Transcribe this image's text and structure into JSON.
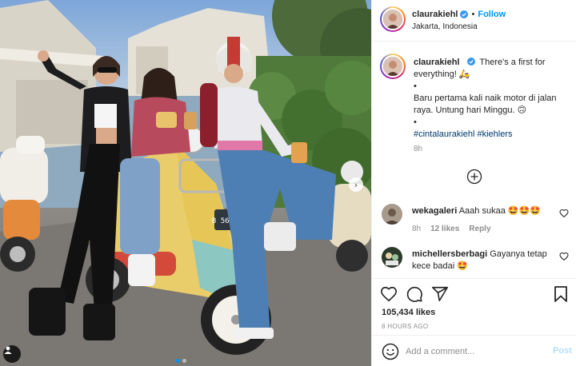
{
  "post": {
    "author": "claurakiehl",
    "follow_label": "Follow",
    "location": "Jakarta, Indonesia",
    "caption_lines": [
      "There's a first for everything! 🛵",
      "•",
      "Baru pertama kali naik motor di jalan raya. Untung hari Minggu. 🙃",
      "•"
    ],
    "hashtags": "#cintalaurakiehl #kiehlers",
    "caption_time": "8h",
    "likes": "105,434 likes",
    "time_ago": "8 HOURS AGO"
  },
  "comments": [
    {
      "username": "wekagaleri",
      "text": "Aaah sukaa 🤩🤩🤩",
      "time": "8h",
      "likes": "12 likes",
      "reply_label": "Reply"
    },
    {
      "username": "michellersberbagi",
      "text": "Gayanya tetap kece badai 🤩"
    }
  ],
  "composer": {
    "placeholder": "Add a comment...",
    "post_label": "Post"
  },
  "colors": {
    "accent": "#0095f6",
    "text": "#262626",
    "muted": "#8e8e8e",
    "hashtag": "#00376b",
    "post_disabled": "#b2dffc"
  },
  "icons": {
    "verified": "verified-badge-icon",
    "like": "heart-icon",
    "comment": "comment-bubble-icon",
    "share": "paper-plane-icon",
    "save": "bookmark-icon",
    "emoji": "smiley-icon",
    "load_more": "plus-circle-icon",
    "user_tag": "user-tag-icon"
  }
}
